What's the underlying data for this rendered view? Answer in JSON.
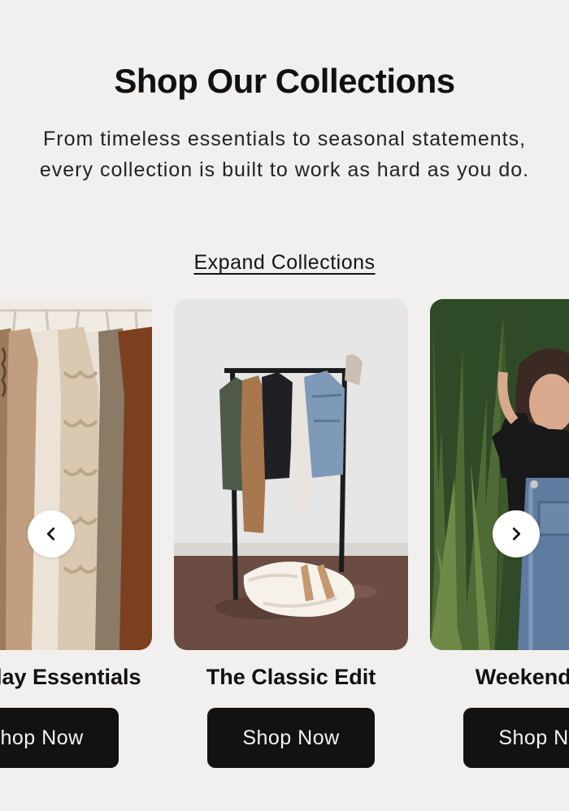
{
  "header": {
    "title": "Shop Our Collections",
    "intro": "From timeless essentials to seasonal statements, every collection is built to work as hard as you do."
  },
  "expand_label": "Expand Collections",
  "carousel": {
    "cards": [
      {
        "title": "Everyday Essentials",
        "button_label": "Shop Now",
        "image": "knitwear-on-hangers"
      },
      {
        "title": "The Classic Edit",
        "button_label": "Shop Now",
        "image": "clothing-rack-with-jackets"
      },
      {
        "title": "Weekend Edit",
        "button_label": "Shop Now",
        "image": "woman-in-denim-overalls"
      }
    ],
    "prev_icon": "chevron-left-icon",
    "next_icon": "chevron-right-icon"
  },
  "colors": {
    "background": "#f1f0ee",
    "button": "#121212",
    "button_text": "#f4f4f4",
    "text": "#141414"
  }
}
